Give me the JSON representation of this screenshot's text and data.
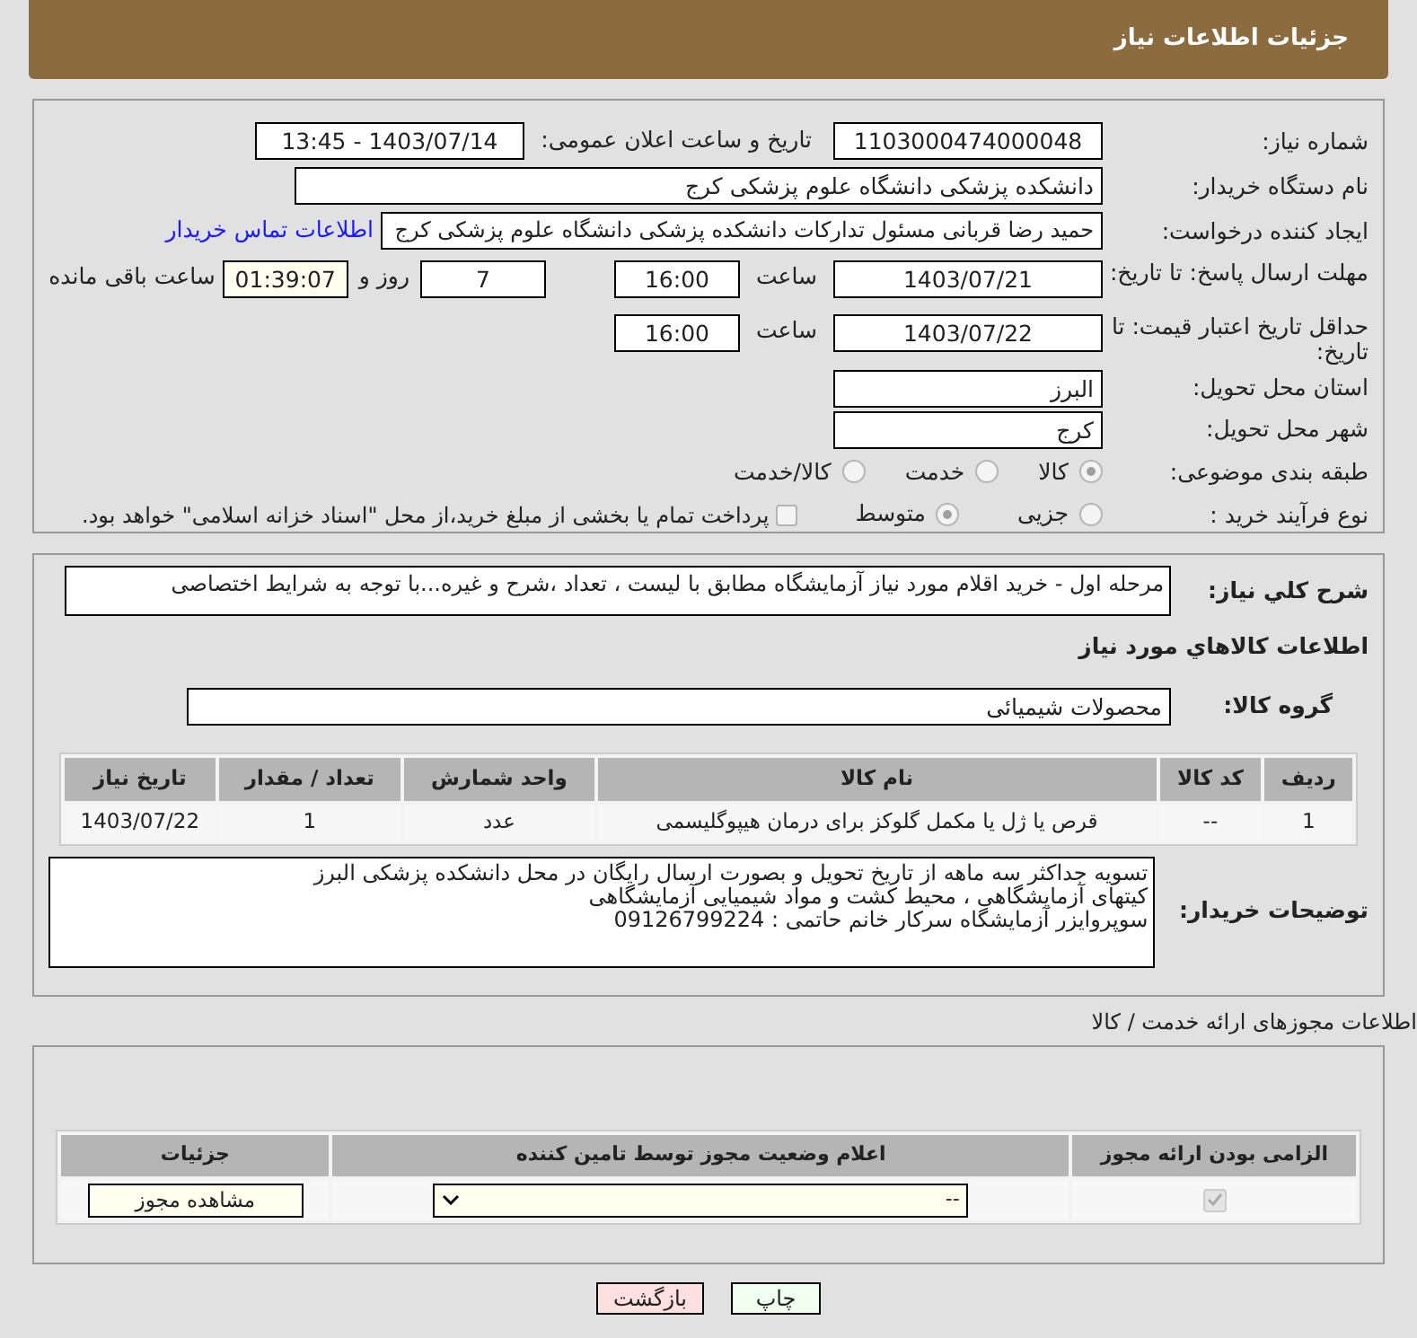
{
  "header": {
    "title": "جزئیات اطلاعات نیاز"
  },
  "details": {
    "need_number": {
      "label": "شماره نیاز:",
      "value": "1103000474000048"
    },
    "announce": {
      "label": "تاریخ و ساعت اعلان عمومی:",
      "value": "1403/07/14 - 13:45"
    },
    "buyer": {
      "label": "نام دستگاه خریدار:",
      "value": "دانشکده پزشکی دانشگاه علوم پزشکی کرج"
    },
    "creator": {
      "label": "ایجاد کننده درخواست:",
      "value": "حمید رضا قربانی مسئول تدارکات دانشکده پزشکی دانشگاه علوم پزشکی کرج",
      "link": "اطلاعات تماس خریدار"
    },
    "deadline": {
      "label": "مهلت ارسال پاسخ: تا تاریخ:",
      "date": "1403/07/21",
      "time_label": "ساعت",
      "time": "16:00",
      "days": "7",
      "days_label": "روز و",
      "remaining": "01:39:07",
      "remaining_label": "ساعت باقی مانده"
    },
    "validity": {
      "label": "حداقل تاریخ اعتبار قیمت: تا تاریخ:",
      "date": "1403/07/22",
      "time_label": "ساعت",
      "time": "16:00"
    },
    "province": {
      "label": "استان محل تحویل:",
      "value": "البرز"
    },
    "city": {
      "label": "شهر محل تحویل:",
      "value": "کرج"
    },
    "category": {
      "label": "طبقه بندی موضوعی:",
      "options": [
        {
          "label": "کالا",
          "selected": true
        },
        {
          "label": "خدمت",
          "selected": false
        },
        {
          "label": "کالا/خدمت",
          "selected": false
        }
      ]
    },
    "process": {
      "label": "نوع فرآیند خرید :",
      "options": [
        {
          "label": "جزیی",
          "selected": false
        },
        {
          "label": "متوسط",
          "selected": true
        }
      ],
      "payment": {
        "checked": false,
        "label": "پرداخت تمام یا بخشی از مبلغ خرید،از محل \"اسناد خزانه اسلامی\" خواهد بود."
      }
    }
  },
  "need": {
    "summary_label": "شرح کلي نياز:",
    "summary": "مرحله اول - خرید اقلام مورد نیاز آزمایشگاه مطابق با لیست ، تعداد ،شرح و غیره...با توجه به شرایط اختصاصی",
    "goods_title": "اطلاعات کالاهاي مورد نياز",
    "group_label": "گروه کالا:",
    "group": "محصولات شیمیائی",
    "table": {
      "columns": [
        "ردیف",
        "کد کالا",
        "نام کالا",
        "واحد شمارش",
        "تعداد / مقدار",
        "تاریخ نیاز"
      ],
      "rows": [
        [
          "1",
          "--",
          "قرص یا ژل یا مکمل گلوکز برای درمان هیپوگلیسمی",
          "عدد",
          "1",
          "1403/07/22"
        ]
      ]
    },
    "notes_label": "توضیحات خریدار:",
    "notes": [
      "تسویه جداکثر سه ماهه از تاریخ تحویل و بصورت ارسال رایگان در محل دانشکده پزشکی البرز",
      "کیتهای آزمایشگاهی ، محیط کشت و مواد شیمیایی آزمایشگاهی",
      "سوپروایزر آزمایشگاه سرکار خانم حاتمی : 09126799224"
    ]
  },
  "permits": {
    "title": "اطلاعات مجوزهای ارائه خدمت / کالا",
    "columns": [
      "الزامی بودن ارائه مجوز",
      "اعلام وضعیت مجوز توسط تامین کننده",
      "جزئیات"
    ],
    "rows": [
      {
        "required": true,
        "status": "--",
        "action": "مشاهده مجوز"
      }
    ]
  },
  "buttons": [
    {
      "kind": "print",
      "label": "چاپ"
    },
    {
      "kind": "back",
      "label": "بازگشت"
    }
  ]
}
